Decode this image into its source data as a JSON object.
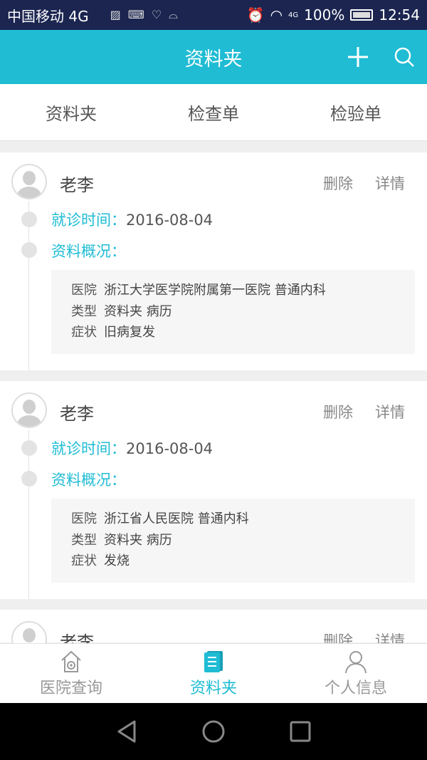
{
  "status_bar": {
    "carrier": "中国移动 4G",
    "battery": "100%",
    "time": "12:54",
    "network": "4G"
  },
  "header": {
    "title": "资料夹",
    "add_icon": "plus-icon",
    "search_icon": "search-icon"
  },
  "tabs": [
    {
      "label": "资料夹"
    },
    {
      "label": "检查单"
    },
    {
      "label": "检验单"
    }
  ],
  "records": [
    {
      "name": "老李",
      "delete": "删除",
      "detail": "详情",
      "visit_label": "就诊时间：",
      "visit_date": "2016-08-04",
      "summary_label": "资料概况：",
      "hospital_key": "医院",
      "hospital": "浙江大学医学院附属第一医院 普通内科",
      "type_key": "类型",
      "type": "资料夹 病历",
      "symptom_key": "症状",
      "symptom": "旧病复发"
    },
    {
      "name": "老李",
      "delete": "删除",
      "detail": "详情",
      "visit_label": "就诊时间：",
      "visit_date": "2016-08-04",
      "summary_label": "资料概况：",
      "hospital_key": "医院",
      "hospital": "浙江省人民医院 普通内科",
      "type_key": "类型",
      "type": "资料夹 病历",
      "symptom_key": "症状",
      "symptom": "发烧"
    },
    {
      "name": "老李",
      "delete": "删除",
      "detail": "详情"
    }
  ],
  "bottom_nav": [
    {
      "label": "医院查询",
      "icon": "hospital-icon"
    },
    {
      "label": "资料夹",
      "icon": "folder-icon",
      "active": true
    },
    {
      "label": "个人信息",
      "icon": "person-icon"
    }
  ],
  "colors": {
    "accent": "#1fbcd4",
    "status_bar": "#1b2550"
  }
}
